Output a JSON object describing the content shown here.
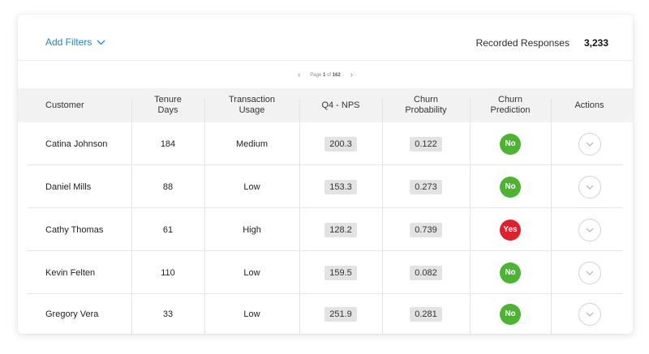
{
  "filters": {
    "label": "Add Filters"
  },
  "responses": {
    "label": "Recorded Responses",
    "count": "3,233"
  },
  "pagination": {
    "prefix": "Page",
    "current": "1",
    "of": "of",
    "total": "162"
  },
  "columns": {
    "customer": "Customer",
    "tenure_1": "Tenure",
    "tenure_2": "Days",
    "usage_1": "Transaction",
    "usage_2": "Usage",
    "nps": "Q4 - NPS",
    "prob_1": "Churn",
    "prob_2": "Probability",
    "pred_1": "Churn",
    "pred_2": "Prediction",
    "actions": "Actions"
  },
  "rows": [
    {
      "customer": "Catina Johnson",
      "tenure": "184",
      "usage": "Medium",
      "nps": "200.3",
      "probability": "0.122",
      "prediction": "No"
    },
    {
      "customer": "Daniel Mills",
      "tenure": "88",
      "usage": "Low",
      "nps": "153.3",
      "probability": "0.273",
      "prediction": "No"
    },
    {
      "customer": "Cathy Thomas",
      "tenure": "61",
      "usage": "High",
      "nps": "128.2",
      "probability": "0.739",
      "prediction": "Yes"
    },
    {
      "customer": "Kevin Felten",
      "tenure": "110",
      "usage": "Low",
      "nps": "159.5",
      "probability": "0.082",
      "prediction": "No"
    },
    {
      "customer": "Gregory Vera",
      "tenure": "33",
      "usage": "Low",
      "nps": "251.9",
      "probability": "0.281",
      "prediction": "No"
    }
  ],
  "colors": {
    "accent": "#1f86c6",
    "no": "#4cb432",
    "yes": "#e0202e"
  },
  "icons": {
    "filter_chevron": "chevron-down-icon",
    "action": "chevron-down-circle-icon",
    "prev": "chevron-left-icon",
    "next": "chevron-right-icon"
  }
}
